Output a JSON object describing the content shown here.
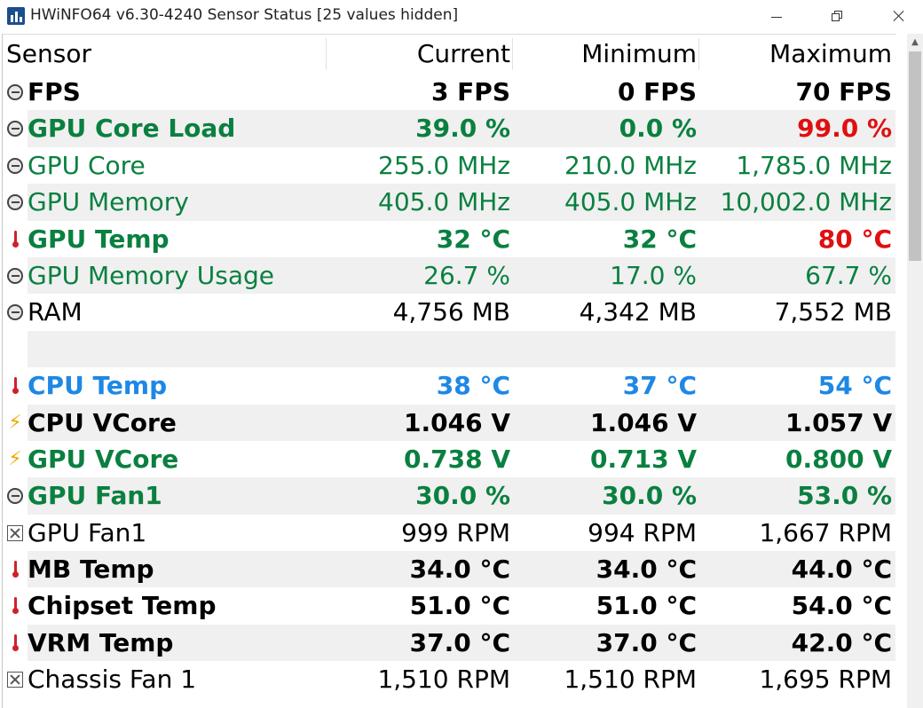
{
  "window": {
    "title": "HWiNFO64 v6.30-4240 Sensor Status [25 values hidden]"
  },
  "colors": {
    "green": "#0a8040",
    "red": "#e01010",
    "blue": "#1e88e5",
    "black": "#000000"
  },
  "table": {
    "headers": {
      "sensor": "Sensor",
      "current": "Current",
      "minimum": "Minimum",
      "maximum": "Maximum"
    },
    "rows": [
      {
        "icon": "clock-icon",
        "name": "FPS",
        "current": "3 FPS",
        "minimum": "0 FPS",
        "maximum": "70 FPS",
        "bold": true,
        "color": "black",
        "max_color": "black",
        "shaded": false
      },
      {
        "icon": "clock-icon",
        "name": "GPU Core Load",
        "current": "39.0 %",
        "minimum": "0.0 %",
        "maximum": "99.0 %",
        "bold": true,
        "color": "green",
        "max_color": "red",
        "shaded": true
      },
      {
        "icon": "clock-icon",
        "name": "GPU Core",
        "current": "255.0 MHz",
        "minimum": "210.0 MHz",
        "maximum": "1,785.0 MHz",
        "bold": false,
        "color": "green",
        "max_color": "green",
        "shaded": false
      },
      {
        "icon": "clock-icon",
        "name": "GPU Memory",
        "current": "405.0 MHz",
        "minimum": "405.0 MHz",
        "maximum": "10,002.0 MHz",
        "bold": false,
        "color": "green",
        "max_color": "green",
        "shaded": true
      },
      {
        "icon": "thermometer-icon",
        "name": "GPU Temp",
        "current": "32 °C",
        "minimum": "32 °C",
        "maximum": "80 °C",
        "bold": true,
        "color": "green",
        "max_color": "red",
        "shaded": false
      },
      {
        "icon": "clock-icon",
        "name": "GPU Memory Usage",
        "current": "26.7 %",
        "minimum": "17.0 %",
        "maximum": "67.7 %",
        "bold": false,
        "color": "green",
        "max_color": "green",
        "shaded": true
      },
      {
        "icon": "clock-icon",
        "name": "RAM",
        "current": "4,756 MB",
        "minimum": "4,342 MB",
        "maximum": "7,552 MB",
        "bold": false,
        "color": "black",
        "max_color": "black",
        "shaded": false
      },
      {
        "icon": "",
        "name": "",
        "current": "",
        "minimum": "",
        "maximum": "",
        "bold": false,
        "color": "black",
        "max_color": "black",
        "shaded": true,
        "spacer": true
      },
      {
        "icon": "thermometer-icon",
        "name": "CPU Temp",
        "current": "38 °C",
        "minimum": "37 °C",
        "maximum": "54 °C",
        "bold": true,
        "color": "blue",
        "max_color": "blue",
        "shaded": false
      },
      {
        "icon": "bolt-icon",
        "name": "CPU VCore",
        "current": "1.046 V",
        "minimum": "1.046 V",
        "maximum": "1.057 V",
        "bold": true,
        "color": "black",
        "max_color": "black",
        "shaded": true
      },
      {
        "icon": "bolt-icon",
        "name": "GPU VCore",
        "current": "0.738 V",
        "minimum": "0.713 V",
        "maximum": "0.800 V",
        "bold": true,
        "color": "green",
        "max_color": "green",
        "shaded": false
      },
      {
        "icon": "clock-icon",
        "name": "GPU Fan1",
        "current": "30.0 %",
        "minimum": "30.0 %",
        "maximum": "53.0 %",
        "bold": true,
        "color": "green",
        "max_color": "green",
        "shaded": true
      },
      {
        "icon": "fan-icon",
        "name": "GPU Fan1",
        "current": "999 RPM",
        "minimum": "994 RPM",
        "maximum": "1,667 RPM",
        "bold": false,
        "color": "black",
        "max_color": "black",
        "shaded": false
      },
      {
        "icon": "thermometer-icon",
        "name": "MB Temp",
        "current": "34.0 °C",
        "minimum": "34.0 °C",
        "maximum": "44.0 °C",
        "bold": true,
        "color": "black",
        "max_color": "black",
        "shaded": true
      },
      {
        "icon": "thermometer-icon",
        "name": "Chipset Temp",
        "current": "51.0 °C",
        "minimum": "51.0 °C",
        "maximum": "54.0 °C",
        "bold": true,
        "color": "black",
        "max_color": "black",
        "shaded": false
      },
      {
        "icon": "thermometer-icon",
        "name": "VRM Temp",
        "current": "37.0 °C",
        "minimum": "37.0 °C",
        "maximum": "42.0 °C",
        "bold": true,
        "color": "black",
        "max_color": "black",
        "shaded": true
      },
      {
        "icon": "fan-icon",
        "name": "Chassis Fan 1",
        "current": "1,510 RPM",
        "minimum": "1,510 RPM",
        "maximum": "1,695 RPM",
        "bold": false,
        "color": "black",
        "max_color": "black",
        "shaded": false
      }
    ]
  }
}
